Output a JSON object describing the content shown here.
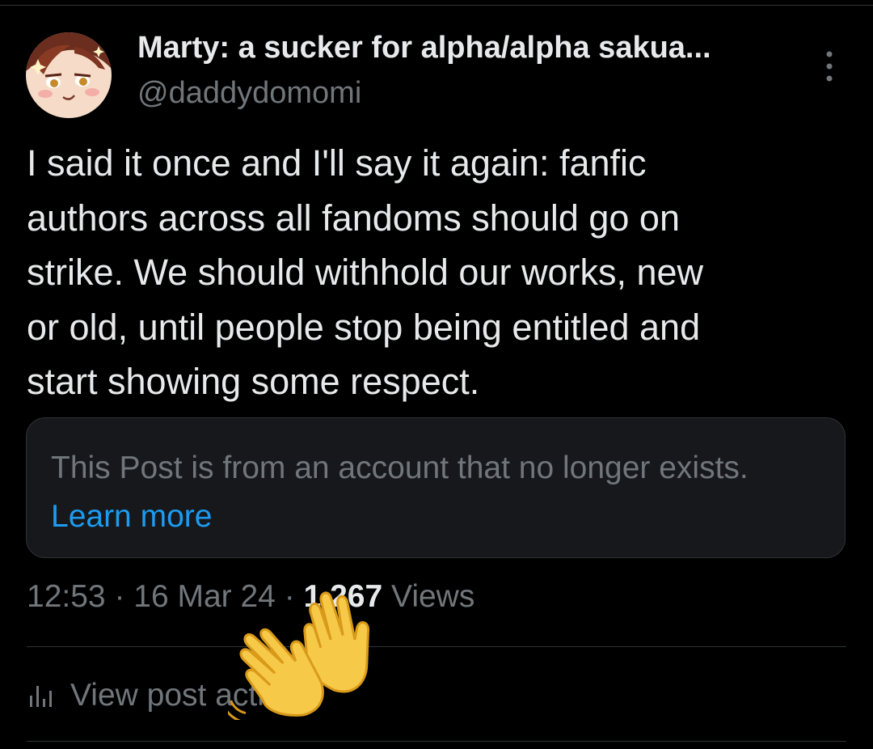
{
  "post": {
    "author": {
      "display_name": "Marty: a sucker for alpha/alpha sakua...",
      "handle": "@daddydomomi"
    },
    "text": "I said it once and I'll say it again: fanfic\nauthors across all fandoms should go on\nstrike. We should withhold our works, new\nor old, until people stop being entitled and\nstart showing some respect.",
    "notice": {
      "text": "This Post is from an account that no longer exists.",
      "link_label": "Learn more"
    },
    "meta": {
      "time": "12:53",
      "separator": " · ",
      "date": "16 Mar 24",
      "views_count": "1,267",
      "views_label": " Views"
    },
    "activity_label": "View post activity"
  },
  "icons": {
    "more": "more-vertical-icon",
    "activity": "bar-chart-icon",
    "overlay": "waving-hands-emoji"
  },
  "colors": {
    "background": "#000000",
    "text_primary": "#e7e9ea",
    "text_secondary": "#71767b",
    "link": "#1d9bf0",
    "divider": "#2f3336",
    "notice_bg": "#16181c"
  }
}
